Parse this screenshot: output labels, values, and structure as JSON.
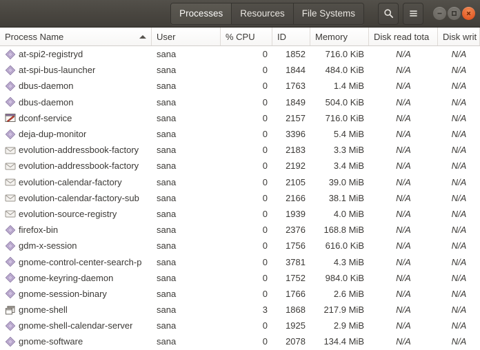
{
  "window": {
    "controls": [
      {
        "name": "minimize",
        "label": "Minimize"
      },
      {
        "name": "maximize",
        "label": "Maximize"
      },
      {
        "name": "close",
        "label": "Close"
      }
    ],
    "close_color": "#dd4814",
    "titlebar_color": "#48453f"
  },
  "header": {
    "tabs": [
      {
        "label": "Processes",
        "active": true
      },
      {
        "label": "Resources",
        "active": false
      },
      {
        "label": "File Systems",
        "active": false
      }
    ],
    "buttons": [
      {
        "label": "Search",
        "icon": "search-icon"
      },
      {
        "label": "Menu",
        "icon": "hamburger-menu-icon"
      }
    ]
  },
  "table": {
    "columns": [
      {
        "key": "name",
        "label": "Process Name",
        "sorted": true,
        "sort_direction": "ascending"
      },
      {
        "key": "user",
        "label": "User"
      },
      {
        "key": "cpu",
        "label": "% CPU"
      },
      {
        "key": "id",
        "label": "ID"
      },
      {
        "key": "memory",
        "label": "Memory"
      },
      {
        "key": "dread",
        "label": "Disk read tota"
      },
      {
        "key": "dwrite",
        "label": "Disk writ"
      }
    ],
    "rows": [
      {
        "icon": "generic-process-icon",
        "name": "at-spi2-registryd",
        "user": "sana",
        "cpu": "0",
        "id": "1852",
        "memory": "716.0 KiB",
        "dread": "N/A",
        "dwrite": "N/A"
      },
      {
        "icon": "generic-process-icon",
        "name": "at-spi-bus-launcher",
        "user": "sana",
        "cpu": "0",
        "id": "1844",
        "memory": "484.0 KiB",
        "dread": "N/A",
        "dwrite": "N/A"
      },
      {
        "icon": "generic-process-icon",
        "name": "dbus-daemon",
        "user": "sana",
        "cpu": "0",
        "id": "1763",
        "memory": "1.4 MiB",
        "dread": "N/A",
        "dwrite": "N/A"
      },
      {
        "icon": "generic-process-icon",
        "name": "dbus-daemon",
        "user": "sana",
        "cpu": "0",
        "id": "1849",
        "memory": "504.0 KiB",
        "dread": "N/A",
        "dwrite": "N/A"
      },
      {
        "icon": "dconf-settings-icon",
        "name": "dconf-service",
        "user": "sana",
        "cpu": "0",
        "id": "2157",
        "memory": "716.0 KiB",
        "dread": "N/A",
        "dwrite": "N/A"
      },
      {
        "icon": "generic-process-icon",
        "name": "deja-dup-monitor",
        "user": "sana",
        "cpu": "0",
        "id": "3396",
        "memory": "5.4 MiB",
        "dread": "N/A",
        "dwrite": "N/A"
      },
      {
        "icon": "envelope-icon",
        "name": "evolution-addressbook-factory",
        "user": "sana",
        "cpu": "0",
        "id": "2183",
        "memory": "3.3 MiB",
        "dread": "N/A",
        "dwrite": "N/A"
      },
      {
        "icon": "envelope-icon",
        "name": "evolution-addressbook-factory",
        "user": "sana",
        "cpu": "0",
        "id": "2192",
        "memory": "3.4 MiB",
        "dread": "N/A",
        "dwrite": "N/A"
      },
      {
        "icon": "envelope-icon",
        "name": "evolution-calendar-factory",
        "user": "sana",
        "cpu": "0",
        "id": "2105",
        "memory": "39.0 MiB",
        "dread": "N/A",
        "dwrite": "N/A"
      },
      {
        "icon": "envelope-icon",
        "name": "evolution-calendar-factory-sub",
        "user": "sana",
        "cpu": "0",
        "id": "2166",
        "memory": "38.1 MiB",
        "dread": "N/A",
        "dwrite": "N/A"
      },
      {
        "icon": "envelope-icon",
        "name": "evolution-source-registry",
        "user": "sana",
        "cpu": "0",
        "id": "1939",
        "memory": "4.0 MiB",
        "dread": "N/A",
        "dwrite": "N/A"
      },
      {
        "icon": "generic-process-icon",
        "name": "firefox-bin",
        "user": "sana",
        "cpu": "0",
        "id": "2376",
        "memory": "168.8 MiB",
        "dread": "N/A",
        "dwrite": "N/A"
      },
      {
        "icon": "generic-process-icon",
        "name": "gdm-x-session",
        "user": "sana",
        "cpu": "0",
        "id": "1756",
        "memory": "616.0 KiB",
        "dread": "N/A",
        "dwrite": "N/A"
      },
      {
        "icon": "generic-process-icon",
        "name": "gnome-control-center-search-p",
        "user": "sana",
        "cpu": "0",
        "id": "3781",
        "memory": "4.3 MiB",
        "dread": "N/A",
        "dwrite": "N/A"
      },
      {
        "icon": "generic-process-icon",
        "name": "gnome-keyring-daemon",
        "user": "sana",
        "cpu": "0",
        "id": "1752",
        "memory": "984.0 KiB",
        "dread": "N/A",
        "dwrite": "N/A"
      },
      {
        "icon": "generic-process-icon",
        "name": "gnome-session-binary",
        "user": "sana",
        "cpu": "0",
        "id": "1766",
        "memory": "2.6 MiB",
        "dread": "N/A",
        "dwrite": "N/A"
      },
      {
        "icon": "window-stack-icon",
        "name": "gnome-shell",
        "user": "sana",
        "cpu": "3",
        "id": "1868",
        "memory": "217.9 MiB",
        "dread": "N/A",
        "dwrite": "N/A"
      },
      {
        "icon": "generic-process-icon",
        "name": "gnome-shell-calendar-server",
        "user": "sana",
        "cpu": "0",
        "id": "1925",
        "memory": "2.9 MiB",
        "dread": "N/A",
        "dwrite": "N/A"
      },
      {
        "icon": "generic-process-icon",
        "name": "gnome-software",
        "user": "sana",
        "cpu": "0",
        "id": "2078",
        "memory": "134.4 MiB",
        "dread": "N/A",
        "dwrite": "N/A"
      }
    ]
  }
}
